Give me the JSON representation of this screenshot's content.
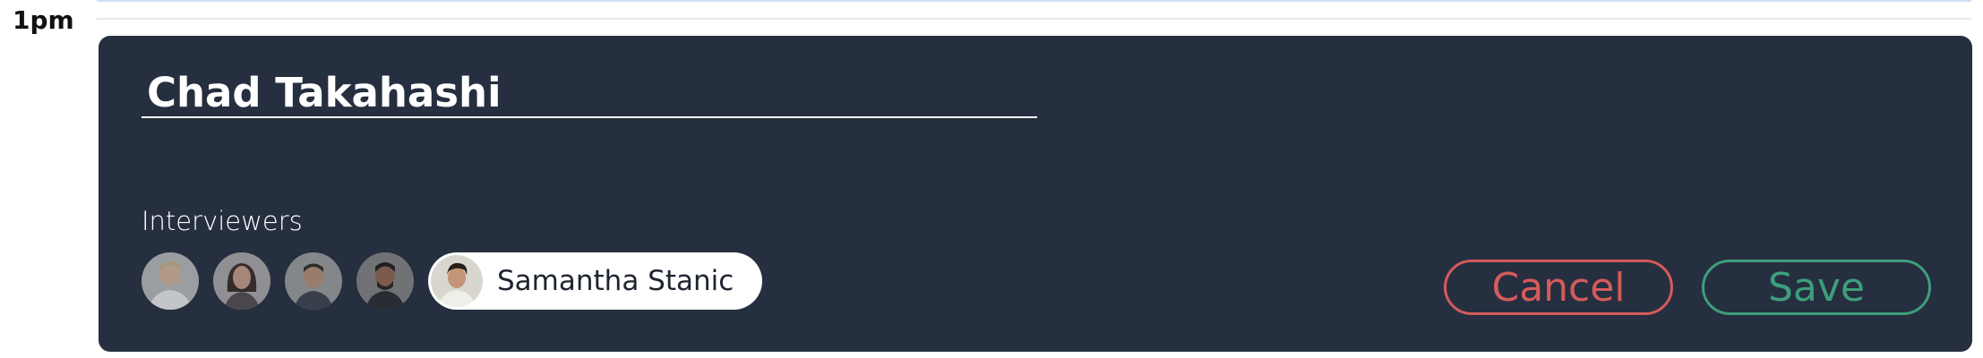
{
  "calendar": {
    "time_label": "1pm"
  },
  "event_editor": {
    "title_value": "Chad Takahashi",
    "interviewers_label": "Interviewers",
    "interviewers": [
      {
        "icon": "avatar-photo-1"
      },
      {
        "icon": "avatar-photo-2"
      },
      {
        "icon": "avatar-photo-3"
      },
      {
        "icon": "avatar-photo-4"
      }
    ],
    "selected_interviewer": {
      "name": "Samantha Stanic",
      "icon": "avatar-photo-5"
    },
    "cancel_label": "Cancel",
    "save_label": "Save"
  },
  "colors": {
    "panel_bg": "#262f3f",
    "cancel": "#d55b5b",
    "save": "#3e9e7c",
    "text_light": "#ffffff"
  }
}
